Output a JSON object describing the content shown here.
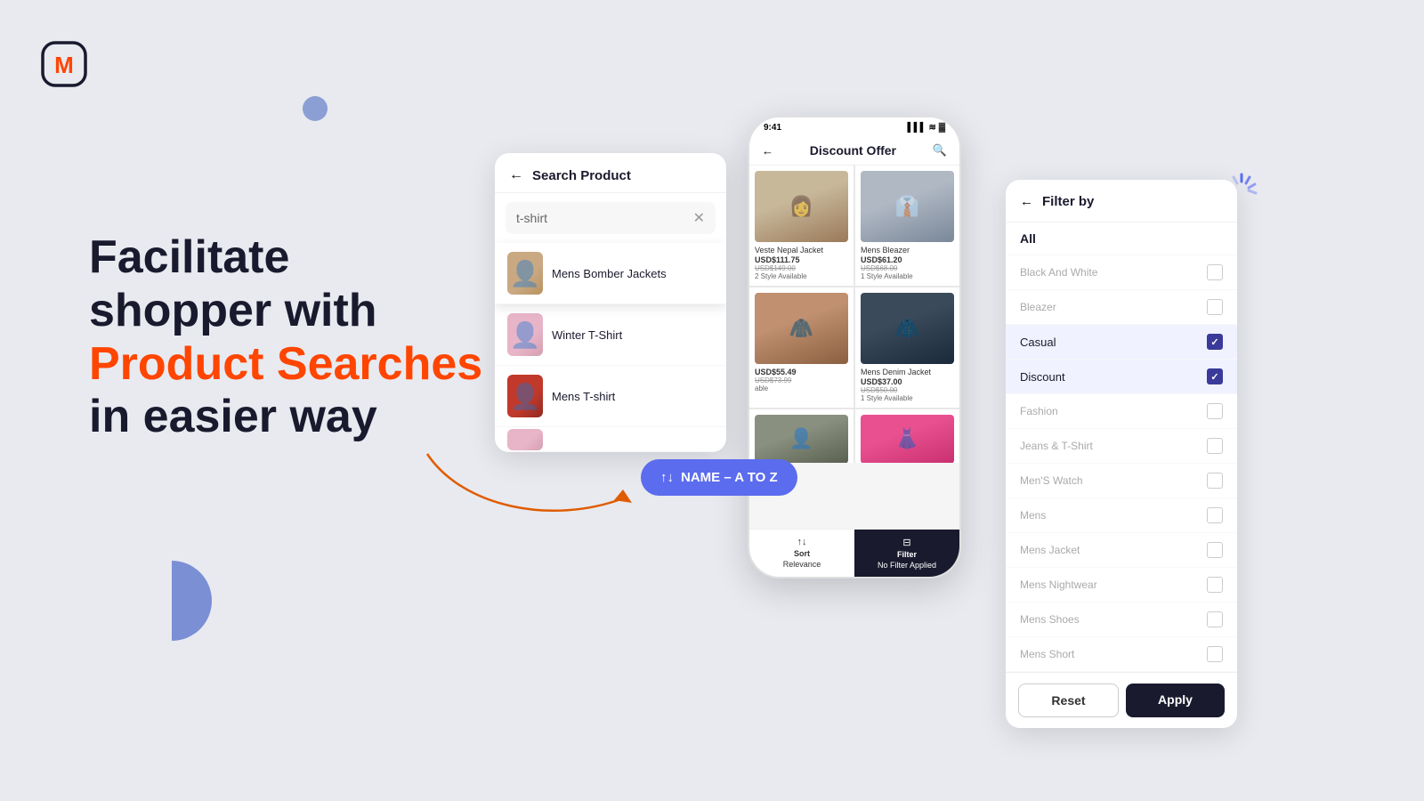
{
  "logo": {
    "alt": "M Logo",
    "letter": "M"
  },
  "hero": {
    "line1": "Facilitate",
    "line2": "shopper with",
    "highlight": "Product Searches",
    "line3": "in easier way"
  },
  "search_panel": {
    "title": "Search Product",
    "input_value": "t-shirt",
    "back_label": "←",
    "clear_label": "✕",
    "results": [
      {
        "id": 1,
        "label": "Mens Bomber Jackets",
        "img_class": "bomber"
      },
      {
        "id": 2,
        "label": "Winter T-Shirt",
        "img_class": "tshirt1"
      },
      {
        "id": 3,
        "label": "Mens T-shirt",
        "img_class": "tshirt2"
      },
      {
        "id": 4,
        "label": "",
        "img_class": "bottom"
      }
    ]
  },
  "sort_pill": {
    "label": "NAME – A TO Z",
    "icon": "↑↓"
  },
  "phone": {
    "status_time": "9:41",
    "status_signal": "▌▌▌",
    "header_title": "Discount Offer",
    "back_label": "←",
    "search_icon": "🔍",
    "products": [
      {
        "id": 1,
        "name": "Veste Nepal Jacket",
        "price": "USD$111.75",
        "old_price": "USD$149.00",
        "avail": "2 Style Available",
        "img_class": "p1"
      },
      {
        "id": 2,
        "name": "Mens Bleazer",
        "price": "USD$61.20",
        "old_price": "USD$68.00",
        "avail": "1 Style Available",
        "img_class": "p2"
      },
      {
        "id": 3,
        "name": "",
        "price": "USD$55.49",
        "old_price": "USD$73.99",
        "avail": "able",
        "img_class": "p3"
      },
      {
        "id": 4,
        "name": "Mens Denim Jacket",
        "price": "USD$37.00",
        "old_price": "USD$50.00",
        "avail": "1 Style Available",
        "img_class": "p4"
      },
      {
        "id": 5,
        "name": "",
        "price": "",
        "old_price": "",
        "avail": "",
        "img_class": "p5"
      },
      {
        "id": 6,
        "name": "",
        "price": "",
        "old_price": "",
        "avail": "",
        "img_class": "p6"
      }
    ],
    "bottom_btns": [
      {
        "label": "Sort",
        "sub": "Relevance",
        "icon": "↑↓"
      },
      {
        "label": "Filter",
        "sub": "No Filter Applied",
        "icon": "⊟"
      }
    ]
  },
  "filter_panel": {
    "title": "Filter by",
    "back_label": "←",
    "items": [
      {
        "id": "all",
        "label": "All",
        "checked": false,
        "style": "all"
      },
      {
        "id": "bw",
        "label": "Black And White",
        "checked": false,
        "style": "muted"
      },
      {
        "id": "bleazer",
        "label": "Bleazer",
        "checked": false,
        "style": "muted"
      },
      {
        "id": "casual",
        "label": "Casual",
        "checked": true,
        "style": "normal"
      },
      {
        "id": "discount",
        "label": "Discount",
        "checked": true,
        "style": "normal"
      },
      {
        "id": "fashion",
        "label": "Fashion",
        "checked": false,
        "style": "muted"
      },
      {
        "id": "jeans",
        "label": "Jeans & T-Shirt",
        "checked": false,
        "style": "muted"
      },
      {
        "id": "menswatch",
        "label": "Men'S Watch",
        "checked": false,
        "style": "muted"
      },
      {
        "id": "mens",
        "label": "Mens",
        "checked": false,
        "style": "muted"
      },
      {
        "id": "mensjacket",
        "label": "Mens Jacket",
        "checked": false,
        "style": "muted"
      },
      {
        "id": "mensnightwear",
        "label": "Mens Nightwear",
        "checked": false,
        "style": "muted"
      },
      {
        "id": "mensshoes",
        "label": "Mens Shoes",
        "checked": false,
        "style": "muted"
      },
      {
        "id": "mensshort",
        "label": "Mens Short",
        "checked": false,
        "style": "muted"
      }
    ],
    "btn_reset": "Reset",
    "btn_apply": "Apply"
  }
}
